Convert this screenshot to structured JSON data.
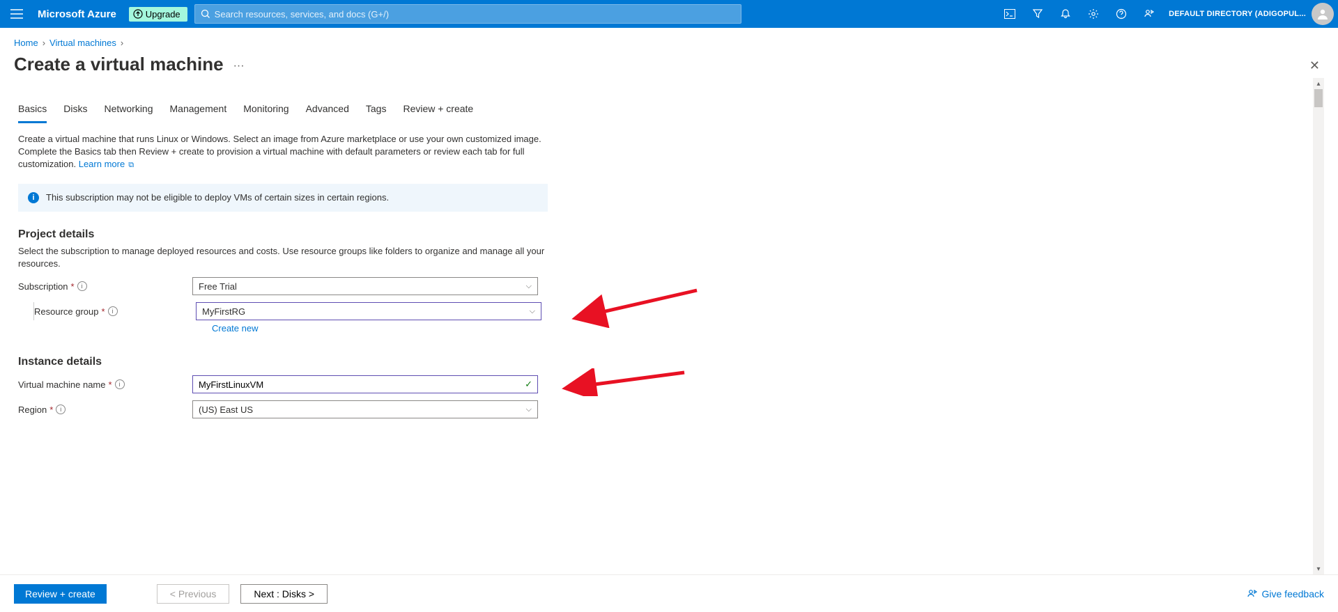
{
  "topbar": {
    "brand": "Microsoft Azure",
    "upgrade_label": "Upgrade",
    "search_placeholder": "Search resources, services, and docs (G+/)",
    "directory": "DEFAULT DIRECTORY (ADIGOPUL..."
  },
  "breadcrumb": {
    "home": "Home",
    "vms": "Virtual machines"
  },
  "page_title": "Create a virtual machine",
  "tabs": [
    "Basics",
    "Disks",
    "Networking",
    "Management",
    "Monitoring",
    "Advanced",
    "Tags",
    "Review + create"
  ],
  "description": "Create a virtual machine that runs Linux or Windows. Select an image from Azure marketplace or use your own customized image. Complete the Basics tab then Review + create to provision a virtual machine with default parameters or review each tab for full customization.",
  "learn_more": "Learn more",
  "infobox": "This subscription may not be eligible to deploy VMs of certain sizes in certain regions.",
  "sections": {
    "project": {
      "title": "Project details",
      "desc": "Select the subscription to manage deployed resources and costs. Use resource groups like folders to organize and manage all your resources.",
      "subscription_label": "Subscription",
      "subscription_value": "Free Trial",
      "rg_label": "Resource group",
      "rg_value": "MyFirstRG",
      "create_new": "Create new"
    },
    "instance": {
      "title": "Instance details",
      "vm_name_label": "Virtual machine name",
      "vm_name_value": "MyFirstLinuxVM",
      "region_label": "Region",
      "region_value": "(US) East US"
    }
  },
  "footer": {
    "review": "Review + create",
    "previous": "< Previous",
    "next": "Next : Disks >",
    "feedback": "Give feedback"
  }
}
